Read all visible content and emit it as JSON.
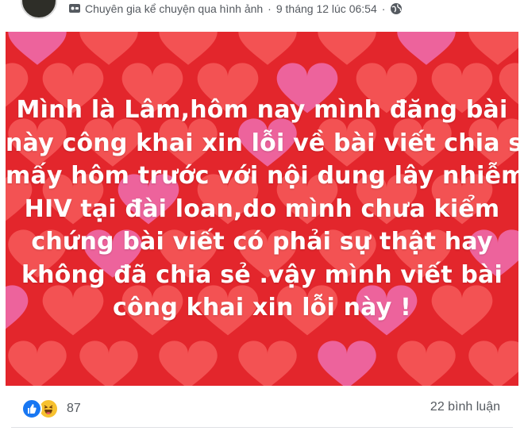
{
  "post": {
    "author_or_page": "Chuyên gia kể chuyện qua hình ảnh",
    "separator": "·",
    "timestamp": "9 tháng 12 lúc 06:54",
    "page_icon": "flag-page-icon",
    "audience_icon": "globe-icon"
  },
  "image": {
    "background_color": "#e3262c",
    "heart_colors": [
      "#f65a5a",
      "#ef6fb0"
    ],
    "text_lines": [
      "Mình là Lâm,hôm nay mình đăng bài",
      "này công khai xin lỗi về bài viết chia sẻ",
      "mấy hôm trước với nội dung lây nhiễm",
      "HIV tại đài loan,do mình chưa kiểm",
      "chứng bài viết có phải sự thật hay",
      "không đã chia sẻ .vậy mình viết bài",
      "công khai xin lỗi này !"
    ]
  },
  "footer": {
    "reaction_icons": [
      "like-icon",
      "haha-icon"
    ],
    "reaction_count": "87",
    "comments": "22 bình luận"
  }
}
